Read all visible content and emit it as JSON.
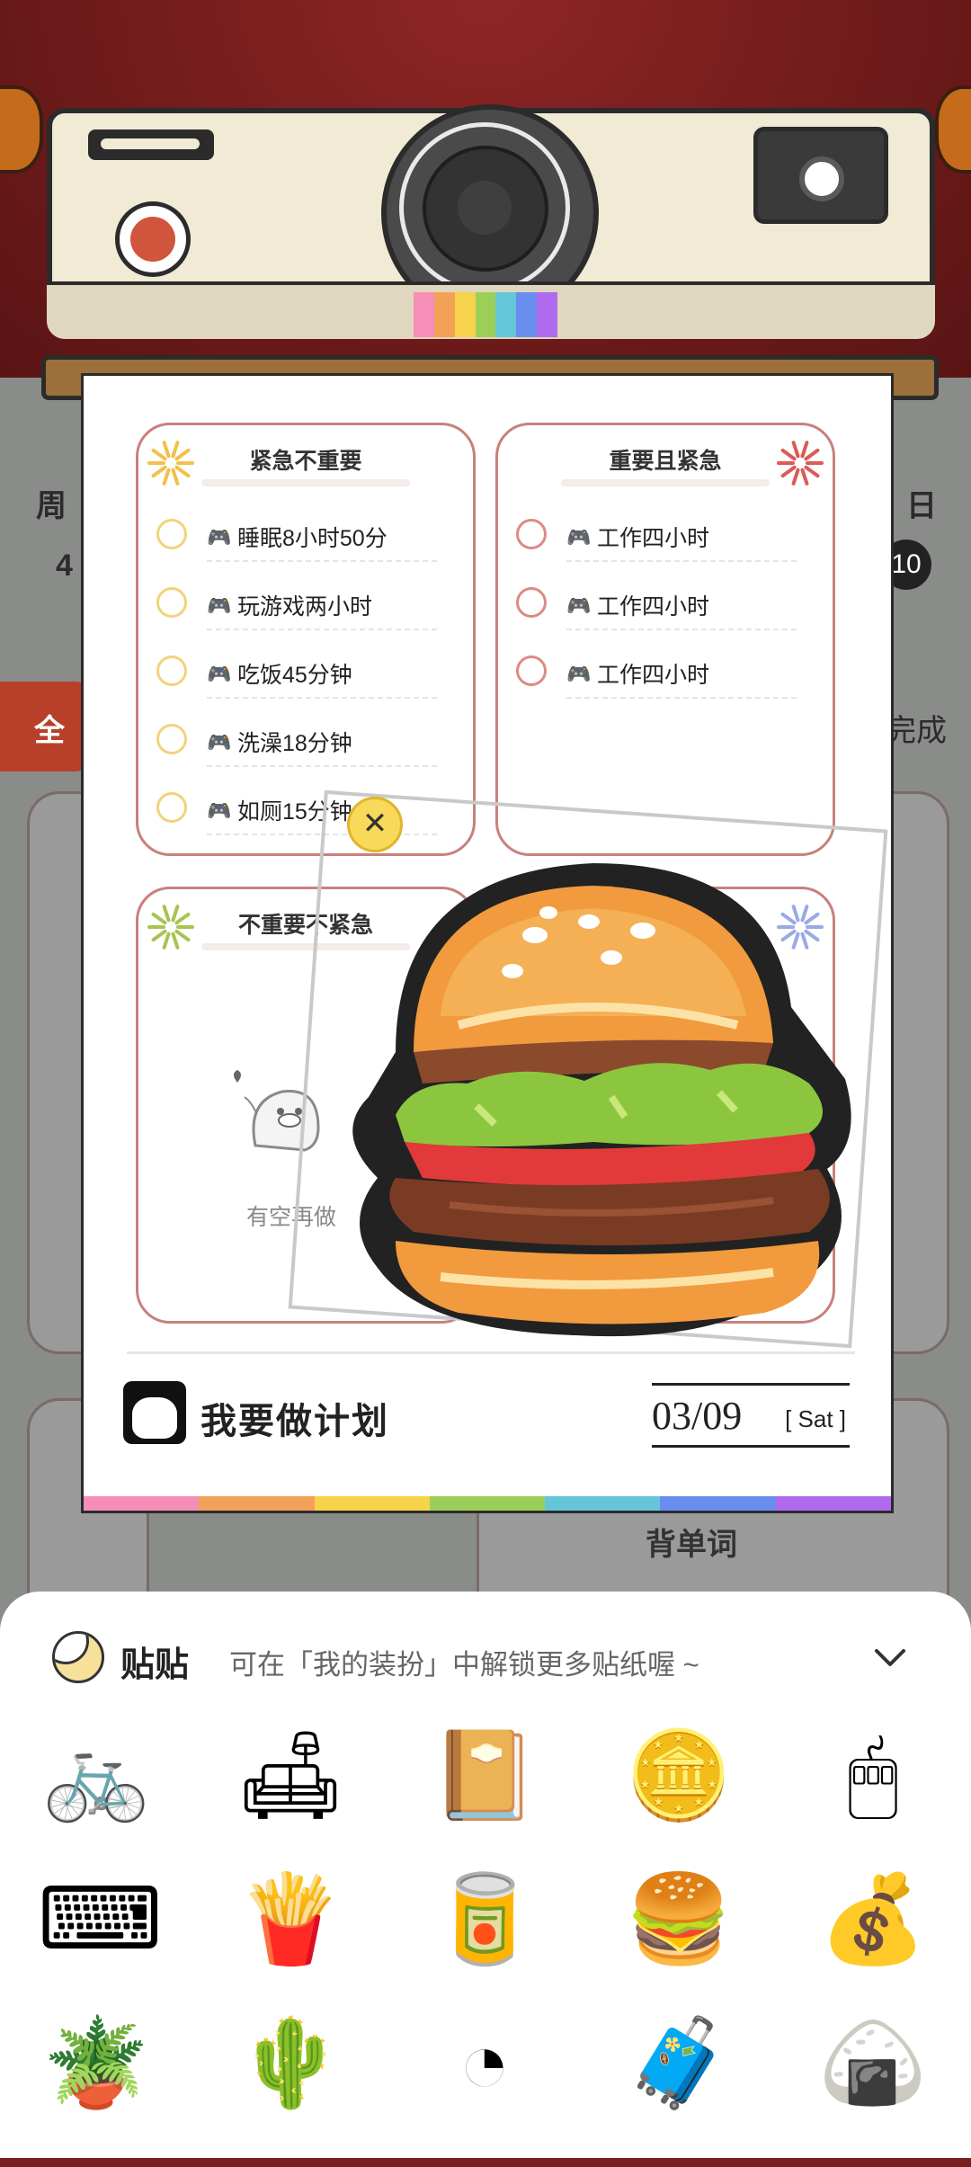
{
  "background": {
    "left_weekday": "周",
    "left_number": "4",
    "left_tab": "全",
    "right_weekday": "日",
    "right_number": "10",
    "right_status": "完成",
    "backdrop_task_label": "背单词"
  },
  "quadrants": [
    {
      "title": "紧急不重要",
      "accent": "#f2c14a",
      "tasks": [
        {
          "label": "睡眠8小时50分"
        },
        {
          "label": "玩游戏两小时"
        },
        {
          "label": "吃饭45分钟"
        },
        {
          "label": "洗澡18分钟"
        },
        {
          "label": "如厕15分钟"
        }
      ]
    },
    {
      "title": "重要且紧急",
      "accent": "#d95c55",
      "tasks": [
        {
          "label": "工作四小时"
        },
        {
          "label": "工作四小时"
        },
        {
          "label": "工作四小时"
        }
      ]
    },
    {
      "title": "不重要不紧急",
      "accent": "#a7c452",
      "empty_text": "有空再做"
    },
    {
      "title": "",
      "accent": "#9aa9e8"
    }
  ],
  "footer": {
    "brand": "我要做计划",
    "date": "03/09",
    "weekday": "[ Sat ]"
  },
  "sticker_panel": {
    "title": "贴贴",
    "hint": "可在「我的装扮」中解锁更多贴纸喔 ~",
    "stickers": [
      "bicycle-icon",
      "armchair-icon",
      "book-icon",
      "coins-icon",
      "mouse-icon",
      "keyboard-icon",
      "fries-icon",
      "soda-can-icon",
      "burger-icon",
      "money-bag-icon",
      "plant-icon",
      "cactus-pot-icon",
      "pie-chart-icon",
      "suitcase-icon",
      "zongzi-icon"
    ]
  },
  "colors": {
    "rainbow": [
      "#f58fb8",
      "#f3a157",
      "#f6d34a",
      "#9ccf58",
      "#66c6d9",
      "#6a8df0",
      "#b06af0"
    ],
    "quad_border": "#c8817a"
  }
}
